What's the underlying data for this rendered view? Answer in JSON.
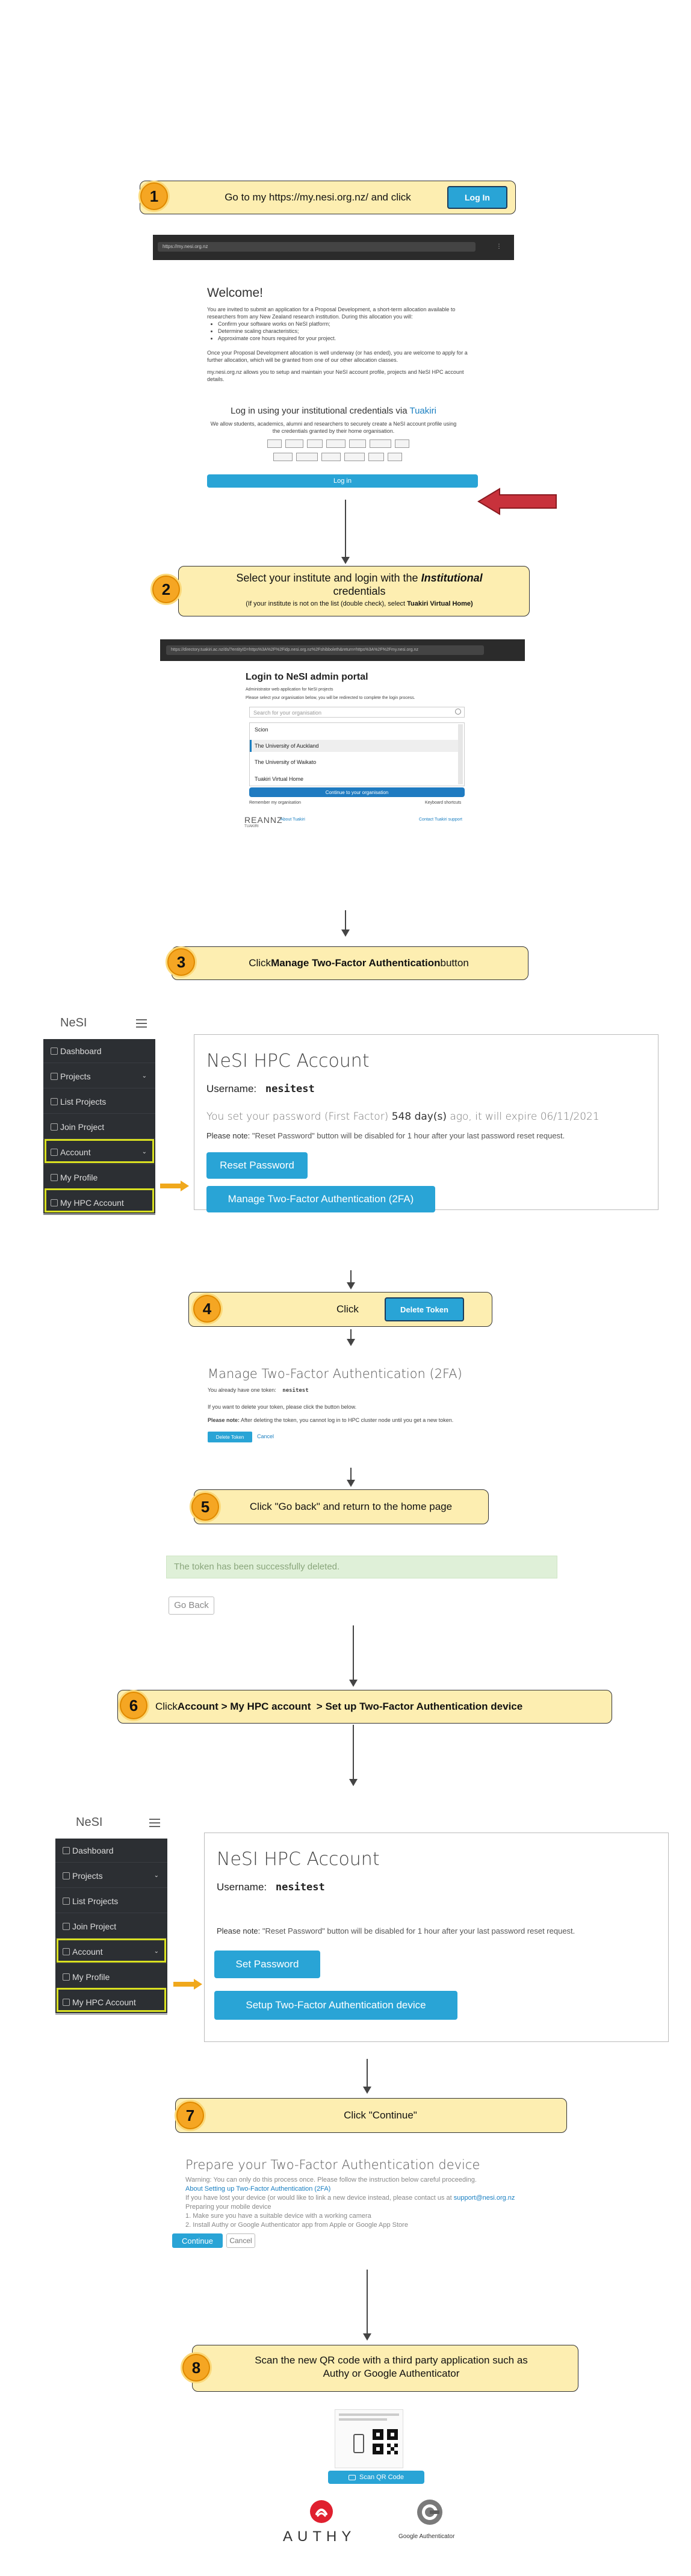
{
  "step1": {
    "num": "1",
    "text": "Go to my https://my.nesi.org.nz/ and click",
    "button": "Log In"
  },
  "browser1": {
    "url": "https://my.nesi.org.nz"
  },
  "welcome": {
    "title": "Welcome!",
    "intro": "You are invited to submit an application for a Proposal Development, a short-term allocation available to researchers from any New Zealand research institution. During this allocation you will:",
    "bullets": [
      "Confirm your software works on NeSI platform;",
      "Determine scaling characteristics;",
      "Approximate core hours required for your project."
    ],
    "para2": "Once your Proposal Development allocation is well underway (or has ended), you are welcome to apply for a further allocation, which will be granted from one of our other allocation classes.",
    "para3": "my.nesi.org.nz allows you to setup and maintain your NeSI account profile, projects and NeSI HPC account details.",
    "login_heading": "Log in using your institutional credentials via",
    "tuakiri": "Tuakiri",
    "login_sub": "We allow students, academics, alumni and researchers to securely create a NeSI account profile using the credentials granted by their home organisation.",
    "login_button": "Log in"
  },
  "step2": {
    "num": "2",
    "line1": "Select your institute and login with the",
    "line1_em": "Institutional",
    "line2": "credentials",
    "note": "(If your institute is not on the list (double check), select",
    "note_bold": "Tuakiri Virtual Home)"
  },
  "browser2": {
    "url": "https://directory.tuakiri.ac.nz/ds/?entityID=https%3A%2F%2Fidp.nesi.org.nz%2Fshibboleth&return=https%3A%2F%2Fmy.nesi.org.nz"
  },
  "portal": {
    "title": "Login to NeSI admin portal",
    "sub1": "Administrator web application for NeSI projects",
    "sub2": "Please select your organisation below, you will be redirected to complete the login process.",
    "search_placeholder": "Search for your organisation",
    "orgs": [
      "Scion",
      "The University of Auckland",
      "The University of Waikato",
      "Tuakiri Virtual Home"
    ],
    "continue": "Continue to your organisation",
    "remember": "Remember my organisation",
    "keyboard": "Keyboard shortcuts",
    "brand": "REANNZ",
    "brand_sub": "TUAKIRI",
    "about": "About Tuakiri",
    "contact": "Contact Tuakiri support"
  },
  "step3": {
    "num": "3",
    "pre": "Click",
    "bold": "Manage Two-Factor Authentication",
    "post": "button"
  },
  "nesi_logo": "NeSI",
  "sidebar1": {
    "items": [
      "Dashboard",
      "Projects",
      "List Projects",
      "Join Project",
      "Account",
      "My Profile",
      "My HPC Account"
    ]
  },
  "hpc1": {
    "title": "NeSI HPC Account",
    "username_label": "Username:",
    "username": "nesitest",
    "pw_pre": "You set your password (First Factor)",
    "pw_days": "548 day(s)",
    "pw_post": "ago, it will expire 06/11/2021",
    "note_label": "Please note:",
    "note": "\"Reset Password\" button will be disabled for 1 hour after your last password reset request.",
    "btn1": "Reset Password",
    "btn2": "Manage Two-Factor Authentication (2FA)"
  },
  "step4": {
    "num": "4",
    "text": "Click",
    "button": "Delete Token"
  },
  "manage2fa": {
    "title": "Manage Two-Factor Authentication (2FA)",
    "have_token": "You already have one token:",
    "token_user": "nesitest",
    "line2": "If you want to delete your token, please click the button below.",
    "note_label": "Please note:",
    "note": "After deleting the token, you cannot log in to HPC cluster node until you get a new token.",
    "delete": "Delete Token",
    "cancel": "Cancel"
  },
  "step5": {
    "num": "5",
    "text": "Click \"Go back\" and return to the home page"
  },
  "deleted_msg": "The token has been successfully deleted.",
  "go_back": "Go Back",
  "step6": {
    "num": "6",
    "pre": "Click",
    "bold": "Account > My HPC account  > Set up Two-Factor Authentication device"
  },
  "sidebar2": {
    "items": [
      "Dashboard",
      "Projects",
      "List Projects",
      "Join Project",
      "Account",
      "My Profile",
      "My HPC Account"
    ]
  },
  "hpc2": {
    "title": "NeSI HPC Account",
    "username_label": "Username:",
    "username": "nesitest",
    "note_label": "Please note:",
    "note": "\"Reset Password\" button will be disabled for 1 hour after your last password reset request.",
    "btn1": "Set Password",
    "btn2": "Setup Two-Factor Authentication device"
  },
  "step7": {
    "num": "7",
    "text": "Click \"Continue\""
  },
  "prepare": {
    "title": "Prepare your Two-Factor Authentication device",
    "l1": "Warning: You can only do this process once. Please follow the instruction below careful proceeding.",
    "l2": "About Setting up Two-Factor Authentication (2FA)",
    "l3": "If you have lost your device (or would like to link a new device instead, please contact us at",
    "l3_link": "support@nesi.org.nz",
    "l4": "Preparing your mobile device",
    "l5": "1. Make sure you have a suitable device with a working camera",
    "l6": "2. Install Authy or Google Authenticator app from Apple or Google App Store",
    "continue": "Continue",
    "cancel": "Cancel"
  },
  "step8": {
    "num": "8",
    "line1": "Scan the new QR code with a third party application such as",
    "line2": "Authy or Google Authenticator"
  },
  "qr": {
    "button": "Scan QR Code",
    "authy": "AUTHY",
    "google": "Google Authenticator"
  }
}
